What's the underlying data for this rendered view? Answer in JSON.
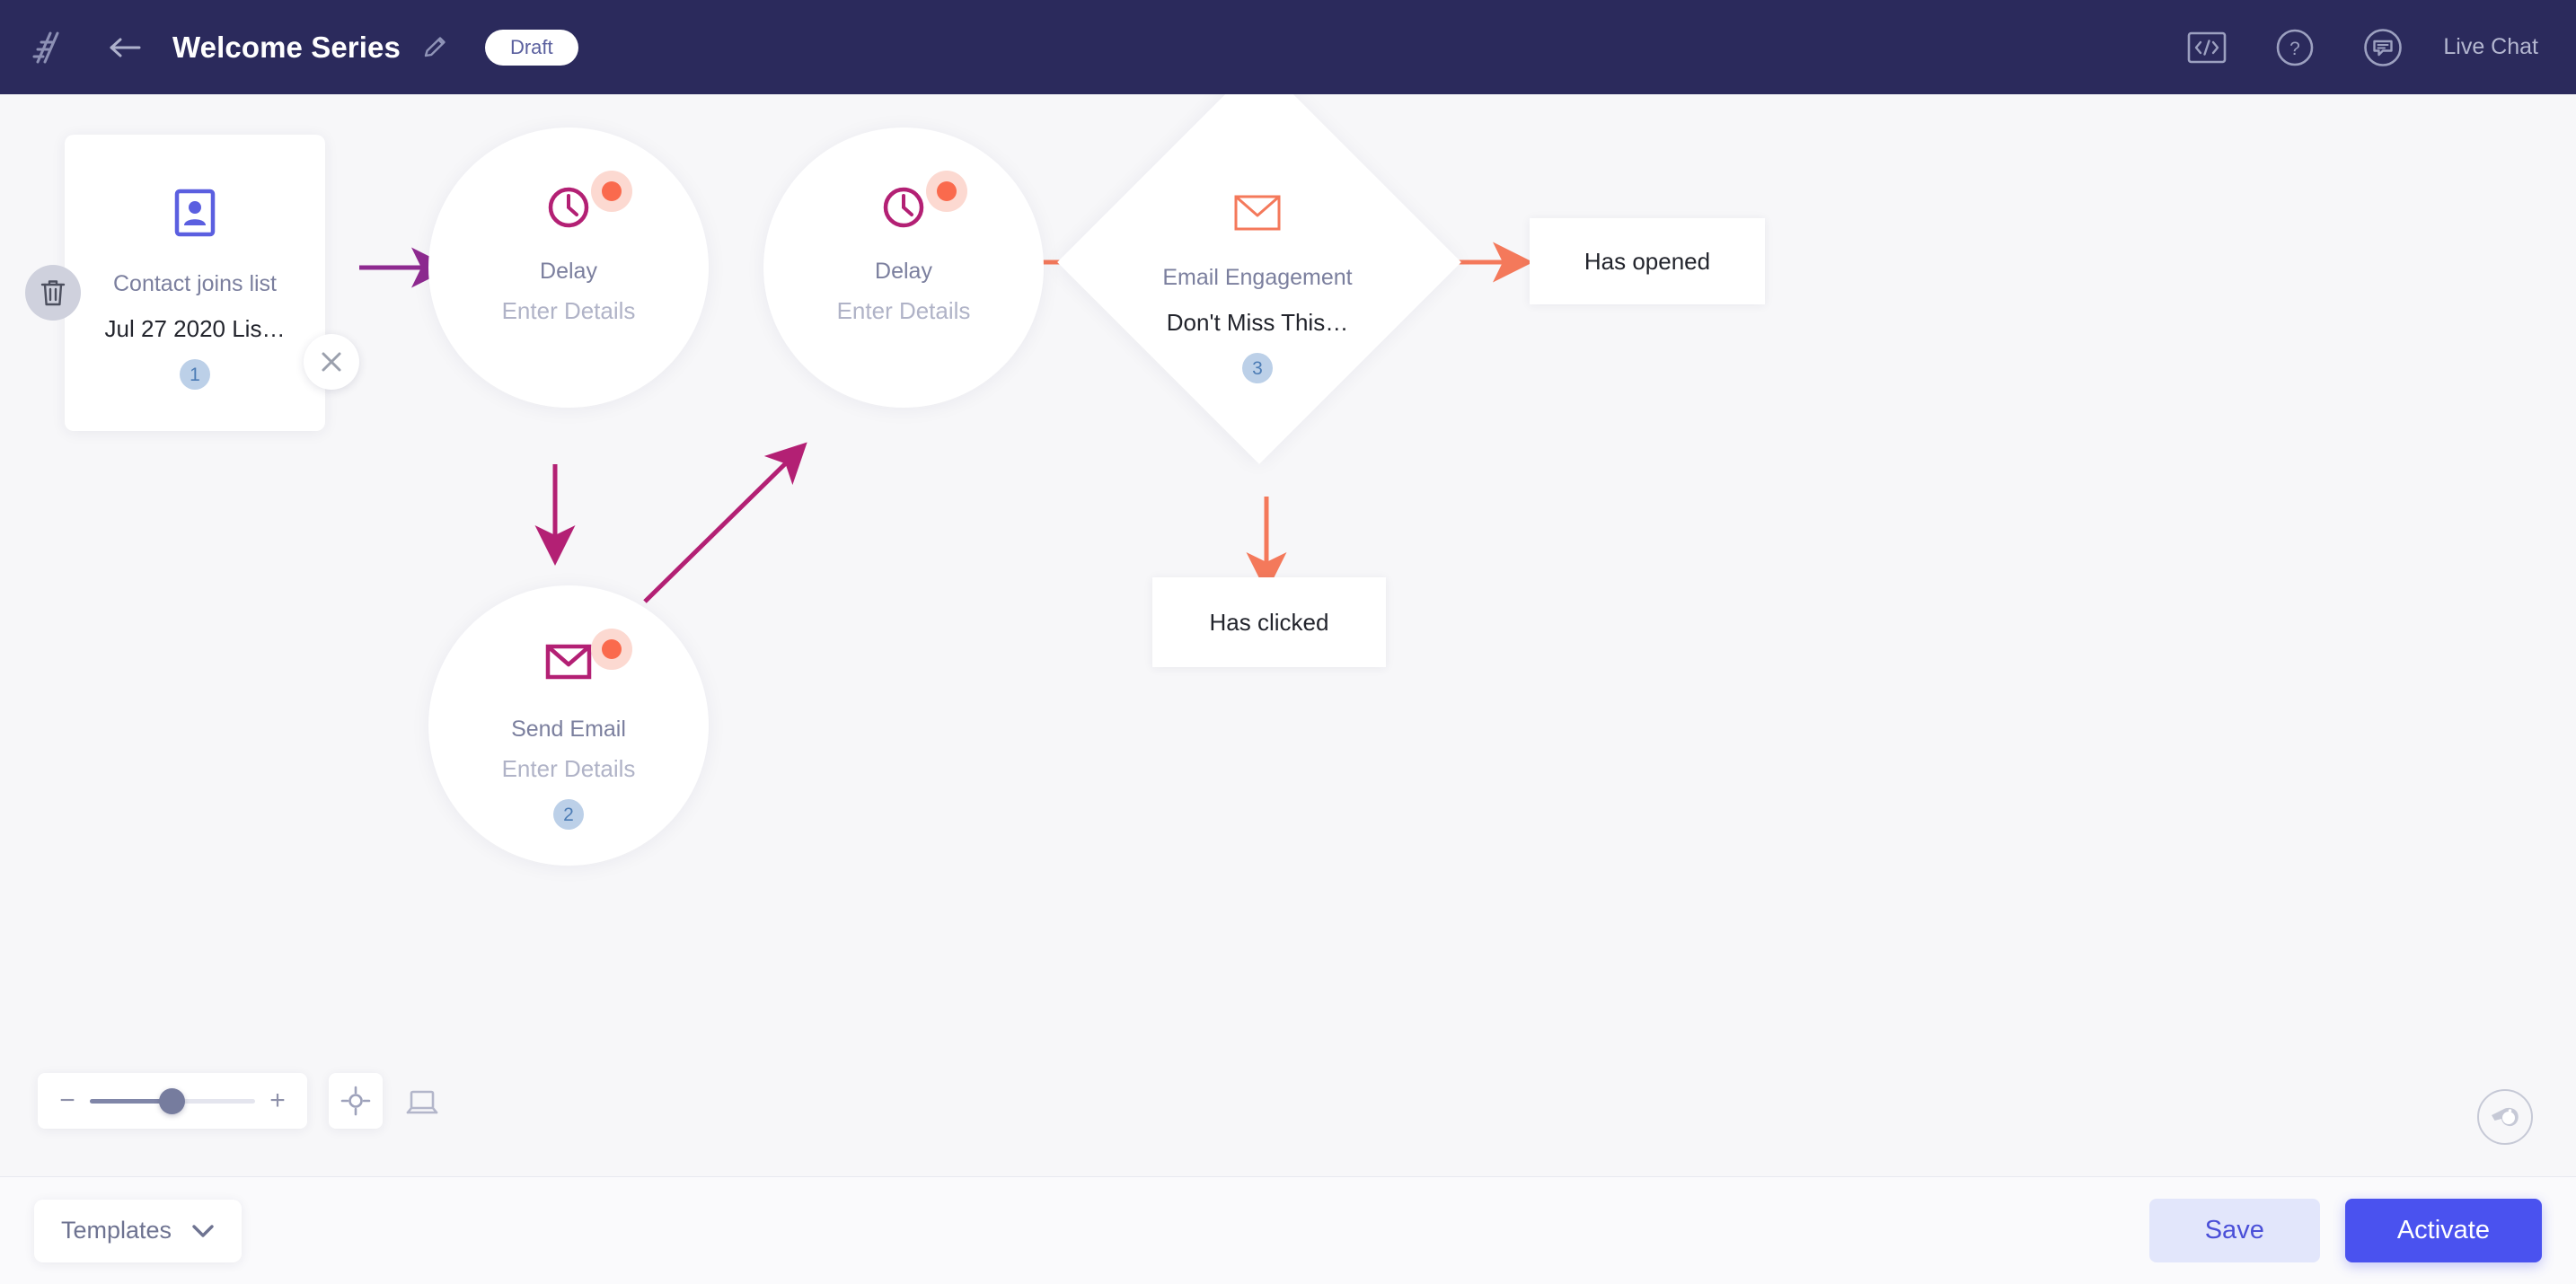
{
  "header": {
    "logo_icon": "slashes-logo-icon",
    "back_icon": "back-arrow-icon",
    "title": "Welcome Series",
    "edit_icon": "pencil-edit-icon",
    "status": "Draft",
    "code_icon": "code-brackets-icon",
    "help_icon": "question-circle-icon",
    "chat_icon": "chat-bubble-circle-icon",
    "live_chat_label": "Live Chat",
    "bg_color": "#2b2a5c",
    "accent_text_color": "#b4b7d0"
  },
  "canvas": {
    "background": "#f7f7f9",
    "trash_icon": "trash-can-icon",
    "close_icon": "close-x-icon",
    "nodes": [
      {
        "id": "trigger",
        "kind": "card",
        "icon": "contact-card-icon",
        "icon_color": "#5b5fe0",
        "title": "Contact joins list",
        "subtitle": "Jul 27 2020 Lis…",
        "step": "1"
      },
      {
        "id": "delay-1",
        "kind": "circle",
        "icon": "clock-icon",
        "icon_color": "#b32074",
        "title": "Delay",
        "subtitle": "Enter Details",
        "alert": true,
        "step": ""
      },
      {
        "id": "send-email",
        "kind": "circle",
        "icon": "envelope-icon",
        "icon_color": "#b32074",
        "title": "Send Email",
        "subtitle": "Enter Details",
        "alert": true,
        "step": "2"
      },
      {
        "id": "delay-2",
        "kind": "circle",
        "icon": "clock-icon",
        "icon_color": "#b32074",
        "title": "Delay",
        "subtitle": "Enter Details",
        "alert": true,
        "step": ""
      },
      {
        "id": "email-engagement",
        "kind": "diamond",
        "icon": "envelope-outline-icon",
        "icon_color": "#f4795b",
        "title": "Email Engagement",
        "subtitle": "Don't Miss This…",
        "step": "3"
      },
      {
        "id": "has-opened",
        "kind": "outcome",
        "label": "Has opened"
      },
      {
        "id": "has-clicked",
        "kind": "outcome",
        "label": "Has clicked"
      }
    ],
    "edge_colors": {
      "purple": "#8e2a90",
      "magenta": "#b32074",
      "orange": "#f4795b"
    }
  },
  "zoom_controls": {
    "minus_label": "−",
    "plus_label": "+",
    "fit_icon": "crosshair-target-icon",
    "device_icon": "laptop-icon",
    "help_icon": "whistle-icon"
  },
  "bottom_bar": {
    "templates_label": "Templates",
    "templates_chevron": "chevron-down-icon",
    "save_label": "Save",
    "activate_label": "Activate",
    "save_color": "#e2e6fb",
    "activate_color": "#4a52ef"
  }
}
